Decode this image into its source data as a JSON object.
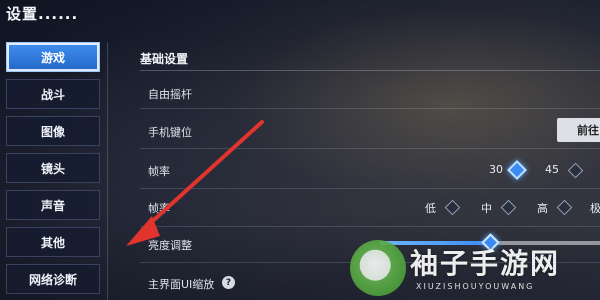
{
  "window": {
    "title": "设置......"
  },
  "sidebar": {
    "items": [
      {
        "label": "游戏",
        "active": true
      },
      {
        "label": "战斗",
        "active": false
      },
      {
        "label": "图像",
        "active": false
      },
      {
        "label": "镜头",
        "active": false
      },
      {
        "label": "声音",
        "active": false
      },
      {
        "label": "其他",
        "active": false
      },
      {
        "label": "网络诊断",
        "active": false
      }
    ]
  },
  "main": {
    "section_title": "基础设置",
    "rows": {
      "free_joystick": {
        "label": "自由摇杆"
      },
      "key_mapping": {
        "label": "手机键位",
        "button": "前往"
      },
      "frame_rate": {
        "label": "帧率",
        "options": [
          "30",
          "45"
        ],
        "selected": "30"
      },
      "quality": {
        "label": "帧率",
        "options": [
          "低",
          "中",
          "高",
          "极"
        ]
      },
      "brightness": {
        "label": "亮度调整",
        "value": 0.5
      },
      "ui_scale": {
        "label": "主界面UI缩放",
        "help_icon": "?"
      }
    }
  },
  "colors": {
    "accent": "#3a8cf2",
    "annotation_arrow": "#e0342c"
  },
  "watermark": {
    "text": "袖子手游网",
    "subtext": "XIUZISHOUYOUWANG"
  }
}
